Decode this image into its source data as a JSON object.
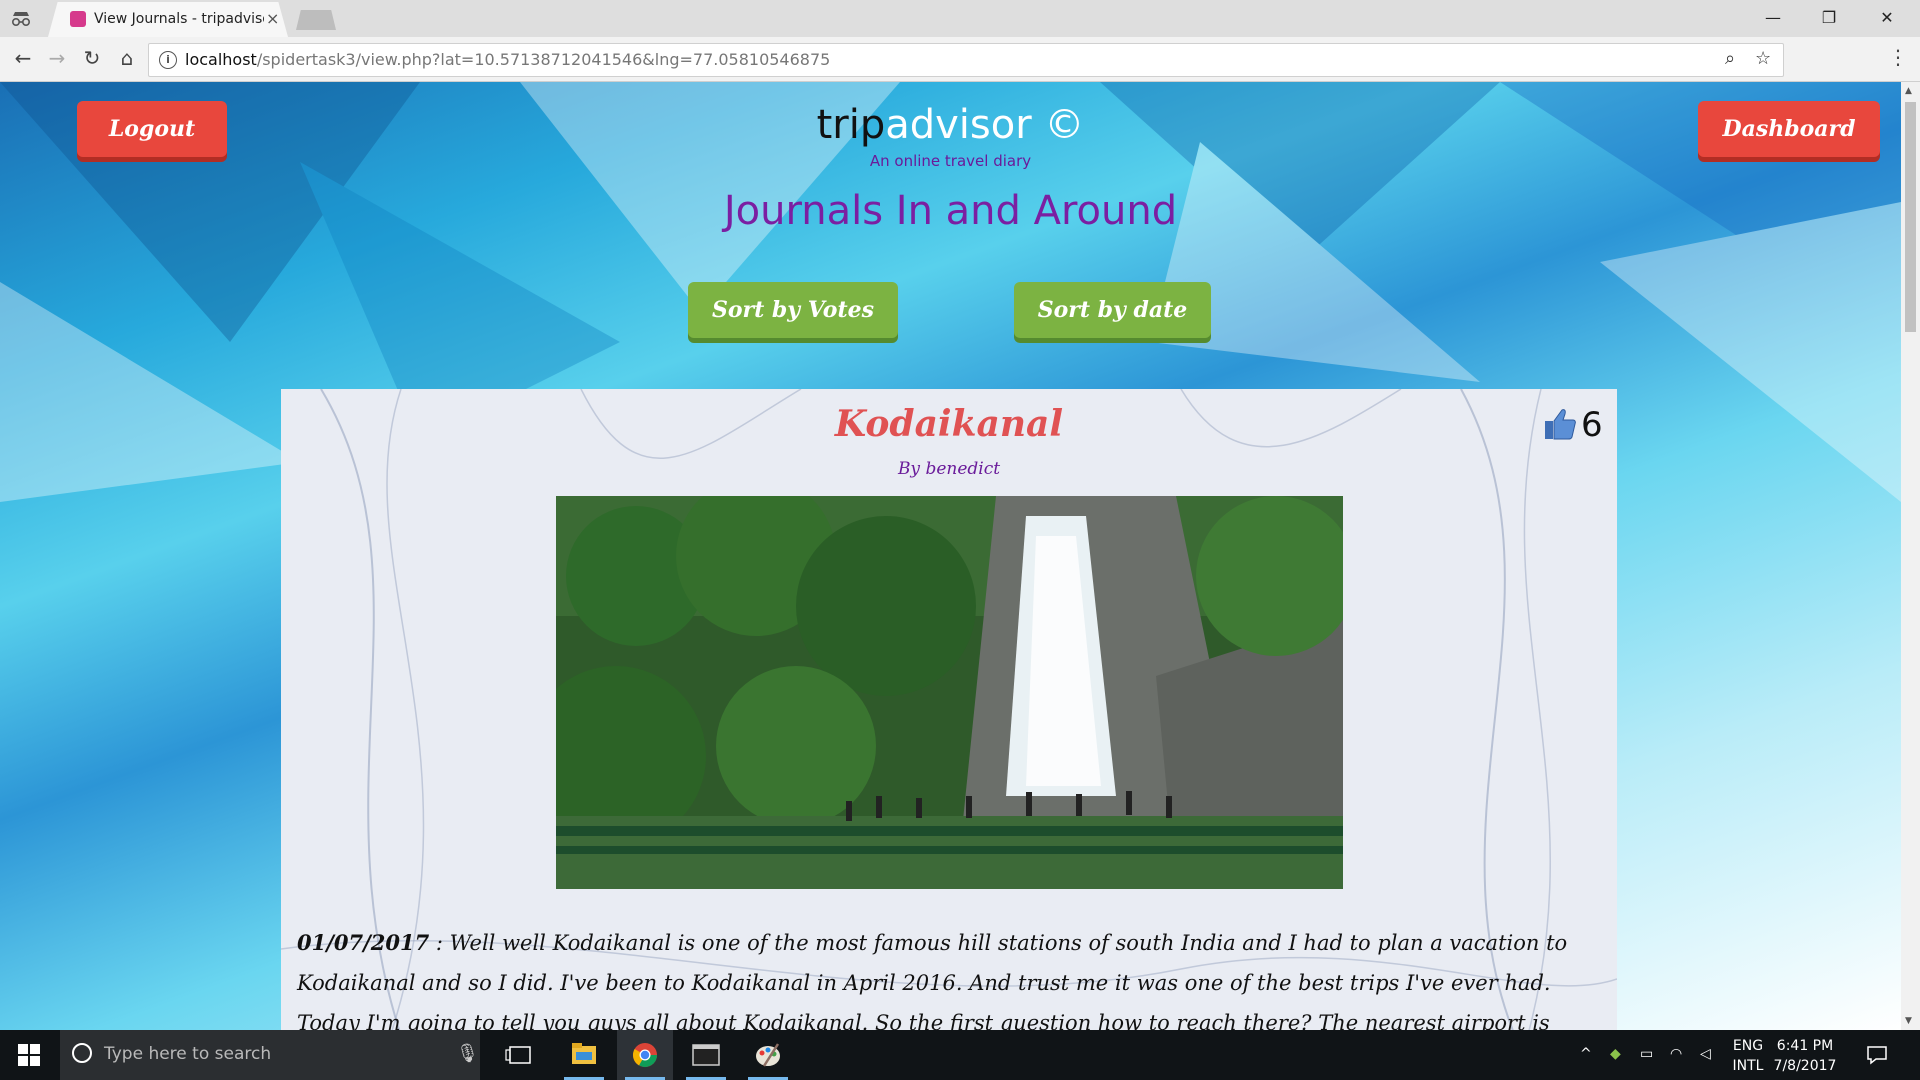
{
  "browser": {
    "tab_title": "View Journals - tripadvisor",
    "tab_close": "×",
    "url_host": "localhost",
    "url_path": "/spidertask3/view.php?lat=10.57138712041546&lng=77.05810546875",
    "info_glyph": "i"
  },
  "window_controls": {
    "minimize": "—",
    "restore": "❐",
    "close": "✕"
  },
  "nav": {
    "back": "←",
    "forward": "→",
    "reload": "↻",
    "home": "⌂",
    "zoom": "⌕",
    "star": "☆",
    "menu": "⋮"
  },
  "header": {
    "logout_label": "Logout",
    "dashboard_label": "Dashboard",
    "brand_trip": "trip",
    "brand_advisor": "advisor ©",
    "tagline": "An online travel diary",
    "page_heading": "Journals In and Around"
  },
  "sort": {
    "votes_label": "Sort by Votes",
    "date_label": "Sort by date"
  },
  "journal": {
    "title": "Kodaikanal",
    "author": "By benedict",
    "votes": "6",
    "date": "01/07/2017",
    "text": " : Well well Kodaikanal is one of the most famous hill stations of south India and I had to plan a vacation to Kodaikanal and so I did. I've been to Kodaikanal in April 2016. And trust me it was one of the best trips I've ever had. Today I'm going to tell you guys all about Kodaikanal. So the first question how to reach there? The nearest airport is Madurai Airport and you can first reach the airport and then take a cab till Kodaikanal but that"
  },
  "taskbar": {
    "search_placeholder": "Type here to search",
    "lang_1": "ENG",
    "lang_2": "INTL",
    "time": "6:41 PM",
    "date": "7/8/2017"
  },
  "colors": {
    "accent_red": "#e8473d",
    "accent_green": "#7cb342",
    "purple": "#7b1fa2"
  },
  "icons": [
    "incognito-icon",
    "back-icon",
    "forward-icon",
    "reload-icon",
    "home-icon",
    "info-icon",
    "zoom-icon",
    "star-icon",
    "menu-icon",
    "thumbs-up-icon",
    "windows-icon",
    "cortana-icon",
    "mic-icon",
    "task-view-icon",
    "file-explorer-icon",
    "chrome-icon",
    "terminal-icon",
    "paint-icon",
    "notification-icon"
  ]
}
